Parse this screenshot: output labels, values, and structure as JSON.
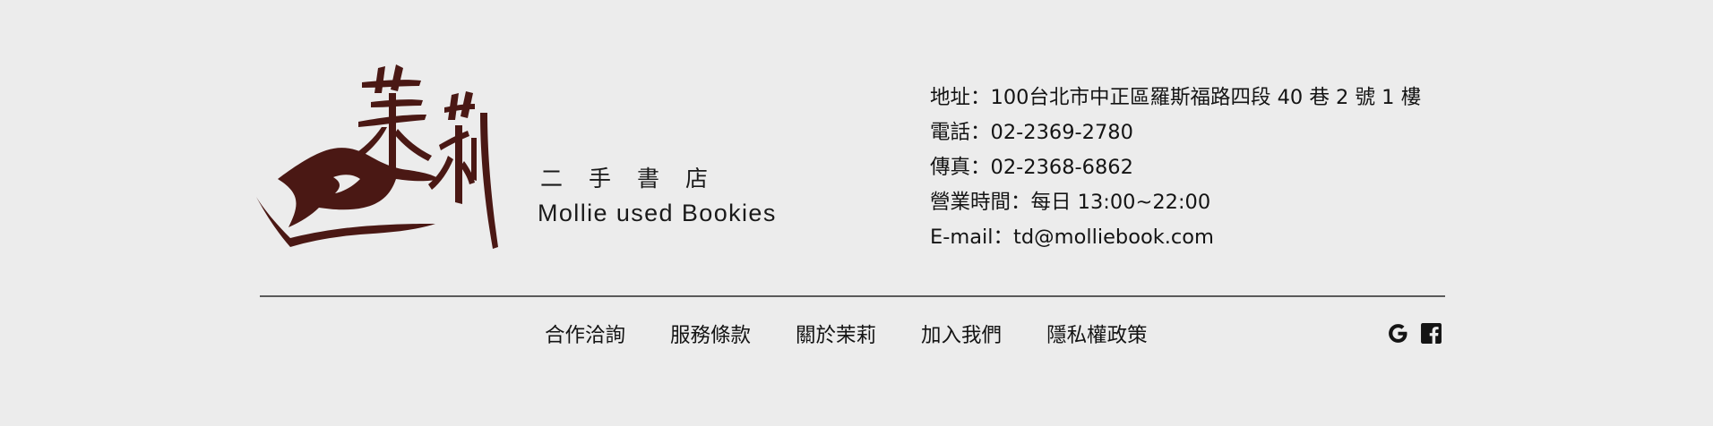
{
  "brand": {
    "logo_text": "茉莉",
    "subtitle": "二手書店",
    "name": "Mollie used Bookies",
    "color": "#4a1814"
  },
  "contact": {
    "address": "地址：100台北市中正區羅斯福路四段 40 巷 2 號 1 樓",
    "phone": "電話：02-2369-2780",
    "fax": "傳真：02-2368-6862",
    "hours": "營業時間：每日 13:00~22:00",
    "email": "E-mail：td@molliebook.com"
  },
  "nav": {
    "items": [
      {
        "label": "合作洽詢"
      },
      {
        "label": "服務條款"
      },
      {
        "label": "關於茉莉"
      },
      {
        "label": "加入我們"
      },
      {
        "label": "隱私權政策"
      }
    ]
  },
  "social": {
    "google_icon": "google-icon",
    "facebook_icon": "facebook-icon"
  }
}
